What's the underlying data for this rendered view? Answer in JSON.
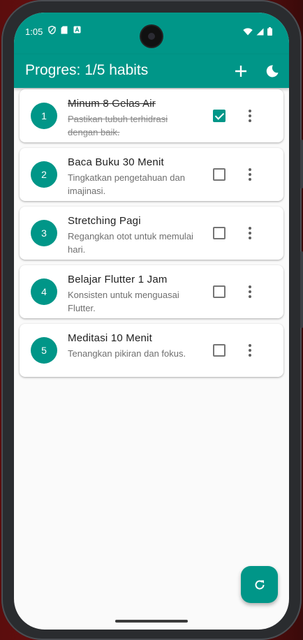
{
  "status_bar": {
    "time": "1:05",
    "left_icons": [
      "shield-icon",
      "sim-card-icon",
      "app-notification-icon"
    ],
    "right_icons": [
      "wifi-icon",
      "signal-icon",
      "battery-icon"
    ]
  },
  "app_bar": {
    "title": "Progres: 1/5 habits",
    "actions": [
      "add-icon",
      "dark-mode-icon"
    ]
  },
  "colors": {
    "primary": "#009688",
    "card": "#ffffff",
    "background": "#fafafa"
  },
  "habits": [
    {
      "number": "1",
      "title": "Minum 8 Gelas Air",
      "description": "Pastikan tubuh terhidrasi dengan baik.",
      "done": true
    },
    {
      "number": "2",
      "title": "Baca Buku 30 Menit",
      "description": "Tingkatkan pengetahuan dan imajinasi.",
      "done": false
    },
    {
      "number": "3",
      "title": "Stretching Pagi",
      "description": "Regangkan otot untuk memulai hari.",
      "done": false
    },
    {
      "number": "4",
      "title": "Belajar Flutter 1 Jam",
      "description": "Konsisten untuk menguasai Flutter.",
      "done": false
    },
    {
      "number": "5",
      "title": "Meditasi 10 Menit",
      "description": "Tenangkan pikiran dan fokus.",
      "done": false
    }
  ],
  "fab": {
    "icon": "refresh-icon"
  }
}
